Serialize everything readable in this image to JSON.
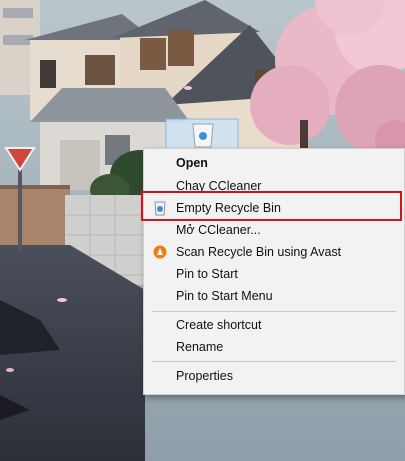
{
  "desktop": {
    "recycle_bin_icon": "recycle-bin-icon",
    "road_sign_icon": "stop-sign-icon"
  },
  "context_menu": {
    "items": [
      {
        "label": "Open",
        "bold": true,
        "icon": ""
      },
      {
        "label": "Chạy CCleaner",
        "icon": ""
      },
      {
        "label": "Empty Recycle Bin",
        "icon": "recycle-bin-small-icon"
      },
      {
        "label": "Mở CCleaner...",
        "icon": ""
      },
      {
        "label": "Scan Recycle Bin using Avast",
        "icon": "avast-icon"
      },
      {
        "label": "Pin to Start",
        "icon": ""
      },
      {
        "label": "Pin to Start Menu",
        "icon": ""
      },
      {
        "label": "Create shortcut",
        "icon": ""
      },
      {
        "label": "Rename",
        "icon": ""
      },
      {
        "label": "Properties",
        "icon": ""
      }
    ]
  },
  "highlight": {
    "target": "Empty Recycle Bin",
    "color": "#d0141b"
  }
}
